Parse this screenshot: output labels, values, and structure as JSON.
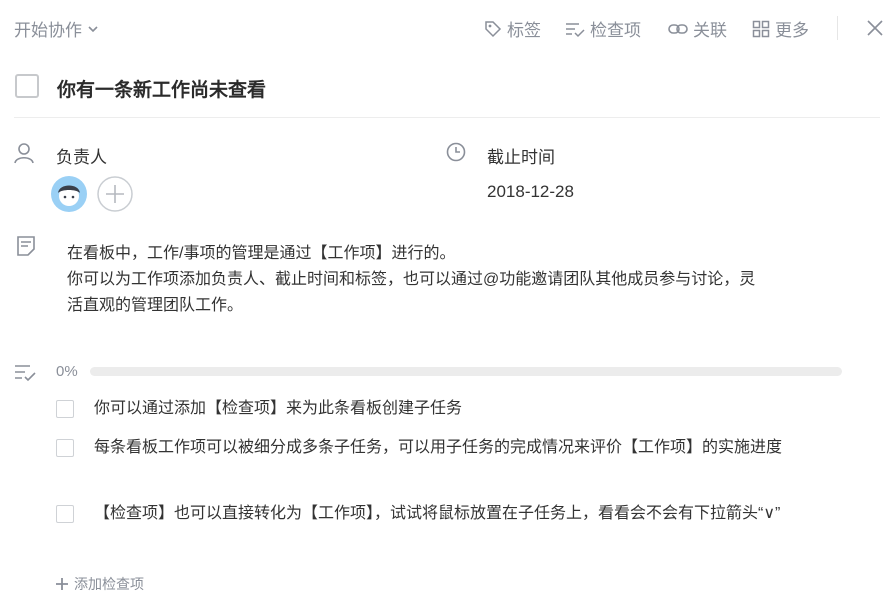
{
  "header": {
    "collab_label": "开始协作",
    "tools": [
      {
        "label": "标签",
        "icon": "tag-icon"
      },
      {
        "label": "检查项",
        "icon": "checklist-icon"
      },
      {
        "label": "关联",
        "icon": "link-icon"
      },
      {
        "label": "更多",
        "icon": "grid-icon"
      }
    ],
    "close_icon": "close-icon"
  },
  "task": {
    "title": "你有一条新工作尚未查看"
  },
  "assignee": {
    "label": "负责人",
    "icon": "person-icon"
  },
  "due": {
    "label": "截止时间",
    "value": "2018-12-28",
    "icon": "clock-icon"
  },
  "description": {
    "icon": "note-icon",
    "lines": [
      "在看板中，工作/事项的管理是通过【工作项】进行的。",
      "你可以为工作项添加负责人、截止时间和标签，也可以通过@功能邀请团队其他成员参与讨论，灵",
      "活直观的管理团队工作。"
    ]
  },
  "checklist": {
    "icon": "checklist-icon",
    "progress_text": "0%",
    "progress": 0,
    "items": [
      {
        "text": "你可以通过添加【检查项】来为此条看板创建子任务",
        "checked": false
      },
      {
        "text": "每条看板工作项可以被细分成多条子任务，可以用子任务的完成情况来评价【工作项】的实施进度",
        "checked": false
      },
      {
        "text": "【检查项】也可以直接转化为【工作项】，试试将鼠标放置在子任务上，看看会不会有下拉箭头“∨”",
        "checked": false
      }
    ],
    "add_label": "添加检查项"
  },
  "colors": {
    "accent": "#4a90e2",
    "muted": "#8a8f99",
    "avatar_bg": "#9ad0f5"
  }
}
